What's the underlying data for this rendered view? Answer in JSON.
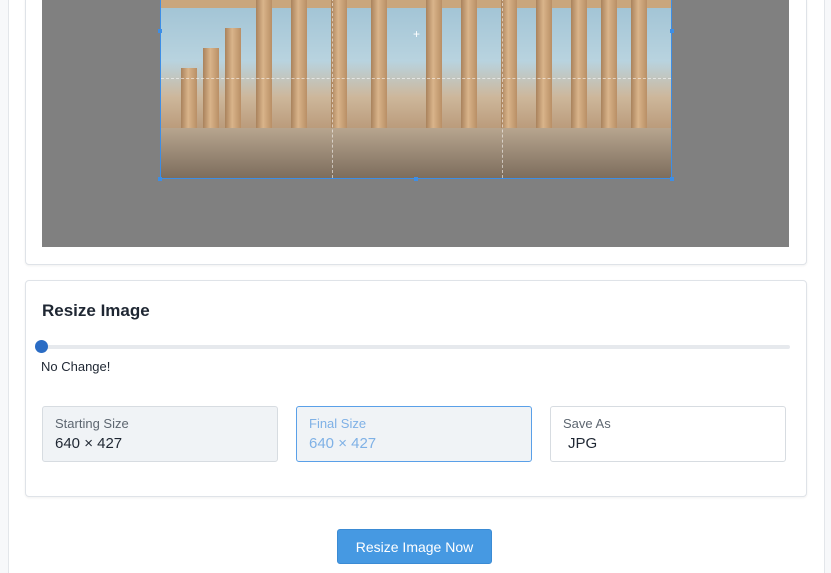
{
  "preview": {
    "image_alt": "Parthenon columns photo"
  },
  "resize": {
    "title": "Resize Image",
    "slider_value_percent": 0,
    "slider_caption": "No Change!",
    "starting_size": {
      "label": "Starting Size",
      "value": "640 × 427"
    },
    "final_size": {
      "label": "Final Size",
      "value": "640 × 427"
    },
    "save_as": {
      "label": "Save As",
      "value": "JPG"
    }
  },
  "action": {
    "button_label": "Resize Image Now"
  },
  "colors": {
    "accent": "#4699e2",
    "slider_thumb": "#2a6cc4",
    "canvas_bg": "#808080"
  },
  "icons": [
    "crosshair-icon"
  ]
}
